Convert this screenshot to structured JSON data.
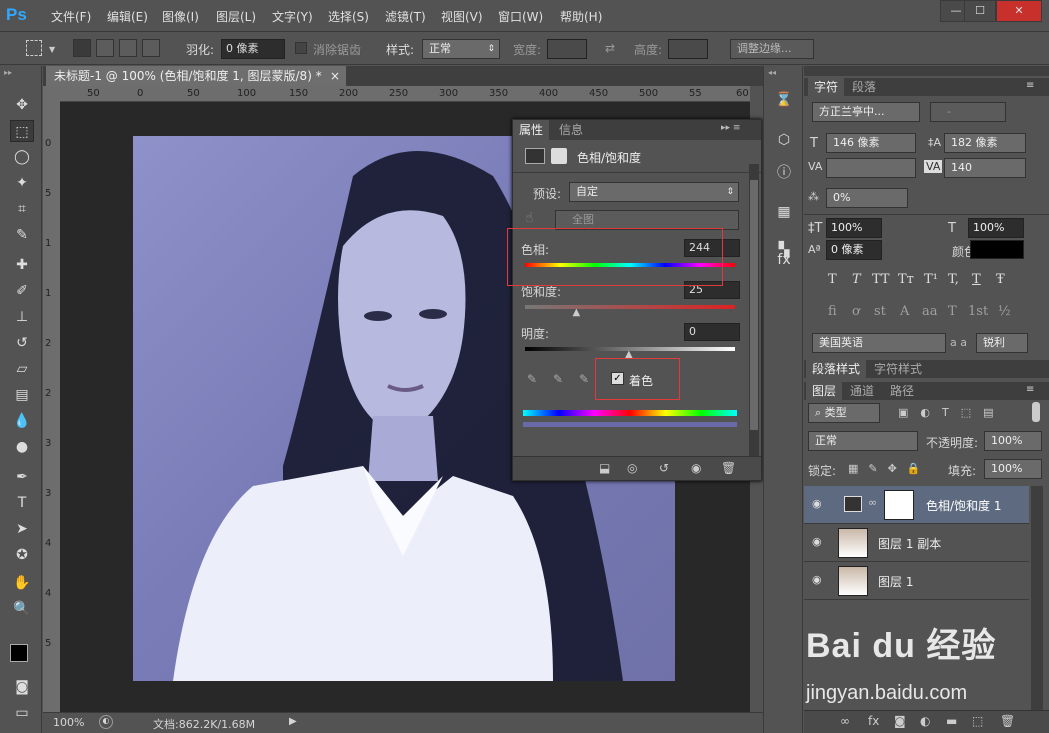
{
  "app": {
    "logo": "Ps",
    "menu": [
      "文件(F)",
      "编辑(E)",
      "图像(I)",
      "图层(L)",
      "文字(Y)",
      "选择(S)",
      "滤镜(T)",
      "视图(V)",
      "窗口(W)",
      "帮助(H)"
    ],
    "window_buttons": [
      "—",
      "☐",
      "✕"
    ]
  },
  "options": {
    "feather_label": "羽化:",
    "feather_value": "0 像素",
    "antialias_label": "消除锯齿",
    "style_label": "样式:",
    "style_value": "正常",
    "width_label": "宽度:",
    "height_label": "高度:",
    "refine_button": "调整边缘..."
  },
  "document": {
    "tab_title": "未标题-1 @ 100% (色相/饱和度 1, 图层蒙版/8) *",
    "ruler_top": [
      "50",
      "0",
      "50",
      "100",
      "150",
      "200",
      "250",
      "300",
      "350",
      "400",
      "450",
      "500",
      "55",
      "60"
    ],
    "ruler_left": [
      "0",
      "5",
      "1",
      "1",
      "2",
      "2",
      "3",
      "3",
      "4",
      "4",
      "5"
    ],
    "zoom": "100%",
    "doc_info": "文档:862.2K/1.68M"
  },
  "properties": {
    "tab_properties": "属性",
    "tab_info": "信息",
    "title": "色相/饱和度",
    "preset_label": "预设:",
    "preset_value": "自定",
    "channel_value": "全图",
    "hue_label": "色相:",
    "hue_value": "244",
    "saturation_label": "饱和度:",
    "saturation_value": "25",
    "lightness_label": "明度:",
    "lightness_value": "0",
    "colorize_label": "着色",
    "colorize_checked": true
  },
  "character": {
    "tab_char": "字符",
    "tab_para": "段落",
    "font_family": "方正兰亭中...",
    "font_style": "-",
    "font_size": "146 像素",
    "leading": "182 像素",
    "kerning": "",
    "tracking": "140",
    "tsume": "0%",
    "vscale": "100%",
    "hscale": "100%",
    "baseline": "0 像素",
    "color_label": "颜色:",
    "type_buttons_1": [
      "T",
      "T",
      "TT",
      "Tт",
      "T¹",
      "T,",
      "T",
      "Ŧ"
    ],
    "type_buttons_2": [
      "fi",
      "ơ",
      "st",
      "A",
      "aa",
      "T",
      "1st",
      "½"
    ],
    "language": "美国英语",
    "aa_label": "a a",
    "aa_value": "锐利"
  },
  "layers_panel": {
    "tab_para_style": "段落样式",
    "tab_char_style": "字符样式",
    "tab_layers": "图层",
    "tab_channels": "通道",
    "tab_paths": "路径",
    "filter_kind": "类型",
    "blend_mode": "正常",
    "opacity_label": "不透明度:",
    "opacity_value": "100%",
    "lock_label": "锁定:",
    "fill_label": "填充:",
    "fill_value": "100%",
    "layers": [
      {
        "name": "色相/饱和度 1",
        "selected": true
      },
      {
        "name": "图层 1 副本",
        "selected": false
      },
      {
        "name": "图层 1",
        "selected": false
      }
    ]
  },
  "watermark": {
    "brand": "Bai du 经验",
    "url": "jingyan.baidu.com"
  }
}
